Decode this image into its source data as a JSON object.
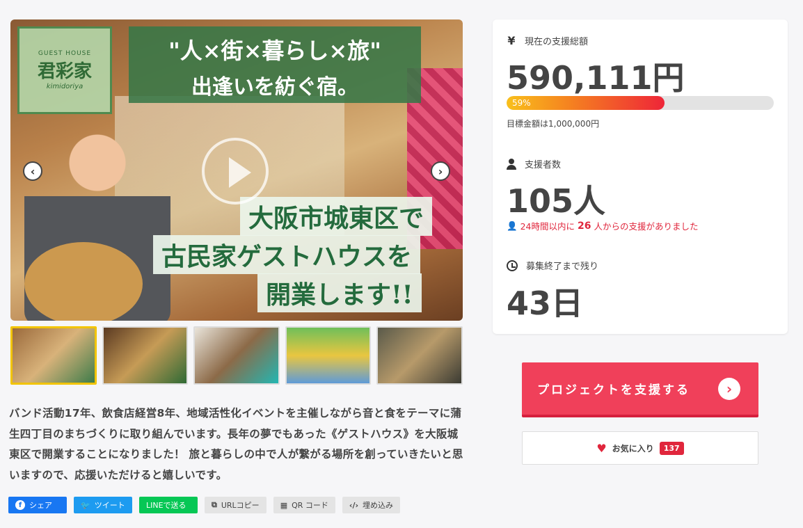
{
  "hero": {
    "logo_header": "GUEST HOUSE",
    "logo_name": "君彩家",
    "logo_roman": "kimidoriya",
    "title_line1": "\"人×街×暮らし×旅\"",
    "title_line2": "出逢いを紡ぐ宿。",
    "banner1": "大阪市城東区で",
    "banner2": "古民家ゲストハウスを",
    "banner3": "開業します!!",
    "prev": "‹",
    "next": "›"
  },
  "thumbnails": [
    {
      "label": "thumb-1",
      "active": true
    },
    {
      "label": "thumb-2",
      "active": false
    },
    {
      "label": "thumb-3",
      "active": false
    },
    {
      "label": "thumb-4",
      "active": false
    },
    {
      "label": "thumb-5",
      "active": false
    }
  ],
  "description": "バンド活動17年、飲食店経営8年、地域活性化イベントを主催しながら音と食をテーマに蒲生四丁目のまちづくりに取り組んでいます。長年の夢でもあった《ゲストハウス》を大阪城東区で開業することになりました！ 旅と暮らしの中で人が繋がる場所を創っていきたいと思いますので、応援いただけると嬉しいです。",
  "share": {
    "facebook": "シェア",
    "twitter": "ツイート",
    "line": "LINEで送る",
    "url_copy": "URLコピー",
    "qr": "QR コード",
    "embed": "埋め込み",
    "facebook_icon": "f",
    "twitter_icon": "🐦",
    "line_icon": "LINE"
  },
  "stats": {
    "total_label": "現在の支援総額",
    "total_icon": "¥",
    "total_value": "590,111円",
    "progress_percent": 59,
    "progress_label": "59%",
    "goal_text": "目標金額は1,000,000円",
    "backers_label": "支援者数",
    "backers_value": "105人",
    "recent_prefix": "24時間以内に",
    "recent_count": "26",
    "recent_suffix": "人からの支援がありました",
    "remaining_label": "募集終了まで残り",
    "remaining_value": "43日"
  },
  "actions": {
    "support_label": "プロジェクトを支援する",
    "support_arrow": "›",
    "favorite_label": "お気に入り",
    "favorite_count": "137"
  },
  "colors": {
    "accent": "#f0405a",
    "facebook": "#1877f2",
    "twitter": "#1d9bf0",
    "line": "#06c755",
    "alert_red": "#e0263c"
  }
}
